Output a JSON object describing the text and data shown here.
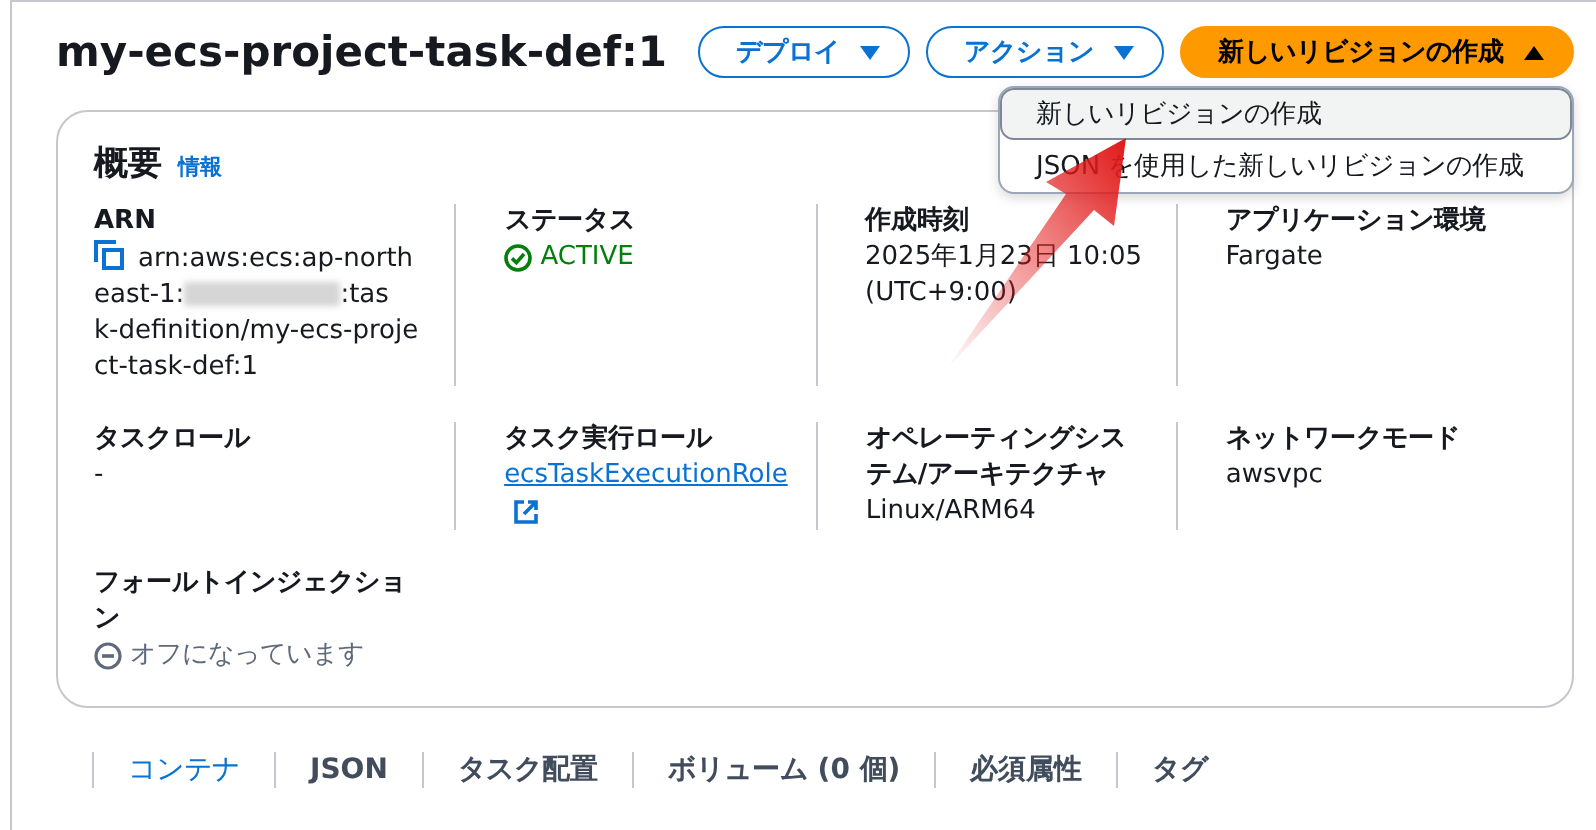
{
  "header": {
    "title": "my-ecs-project-task-def:1",
    "buttons": [
      {
        "label": "デプロイ",
        "kind": "normal",
        "expanded": false
      },
      {
        "label": "アクション",
        "kind": "normal",
        "expanded": false
      },
      {
        "label": "新しいリビジョンの作成",
        "kind": "primary",
        "expanded": true
      }
    ],
    "menu": [
      {
        "label": "新しいリビジョンの作成",
        "highlighted": true
      },
      {
        "label": "JSON を使用した新しいリビジョンの作成",
        "highlighted": false
      }
    ]
  },
  "overview": {
    "title": "概要",
    "info_link": "情報",
    "rows": [
      [
        {
          "label": "ARN",
          "kind": "arn",
          "value_lines": [
            [
              "arn:aws:ecs:ap-north"
            ],
            [
              "east-1:",
              {
                "kind": "redacted"
              },
              ":tas"
            ],
            [
              "k-definition/my-ecs-proje"
            ],
            [
              "ct-task-def:1"
            ]
          ]
        },
        {
          "label": "ステータス",
          "kind": "status",
          "value": "ACTIVE"
        },
        {
          "label": "作成時刻",
          "kind": "text",
          "value": "2025年1月23日 10:05 (UTC+9:00)"
        },
        {
          "label": "アプリケーション環境",
          "kind": "text",
          "value": "Fargate"
        }
      ],
      [
        {
          "label": "タスクロール",
          "kind": "text",
          "value": "-"
        },
        {
          "label": "タスク実行ロール",
          "kind": "link",
          "value": "ecsTaskExecutionRole"
        },
        {
          "label": "オペレーティングシステム/アーキテクチャ",
          "kind": "text",
          "value": "Linux/ARM64"
        },
        {
          "label": "ネットワークモード",
          "kind": "text",
          "value": "awsvpc"
        }
      ],
      [
        {
          "label": "フォールトインジェクション",
          "kind": "off",
          "value": "オフになっています"
        }
      ]
    ]
  },
  "tabs": [
    {
      "label": "コンテナ",
      "selected": true
    },
    {
      "label": "JSON",
      "selected": false
    },
    {
      "label": "タスク配置",
      "selected": false
    },
    {
      "label": "ボリューム (0 個)",
      "selected": false
    },
    {
      "label": "必須属性",
      "selected": false
    },
    {
      "label": "タグ",
      "selected": false
    }
  ]
}
